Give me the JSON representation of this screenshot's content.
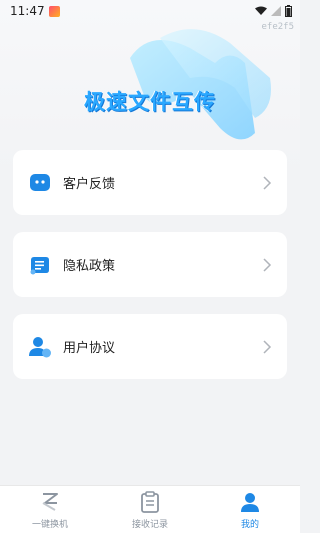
{
  "status_bar": {
    "time": "11:47",
    "watermark": "efe2f5"
  },
  "hero": {
    "title": "极速文件互传"
  },
  "menu": [
    {
      "label": "客户反馈",
      "icon": "chat-bubble-icon"
    },
    {
      "label": "隐私政策",
      "icon": "scroll-document-icon"
    },
    {
      "label": "用户协议",
      "icon": "users-icon"
    }
  ],
  "tabbar": {
    "tabs": [
      {
        "label": "一键换机",
        "icon": "switch-phone-icon",
        "active": false
      },
      {
        "label": "接收记录",
        "icon": "clipboard-icon",
        "active": false
      },
      {
        "label": "我的",
        "icon": "profile-icon",
        "active": true
      }
    ]
  },
  "colors": {
    "accent": "#1e88e5",
    "title": "#2aa8ff",
    "inactive": "#8c95a0",
    "background": "#f2f3f5"
  }
}
